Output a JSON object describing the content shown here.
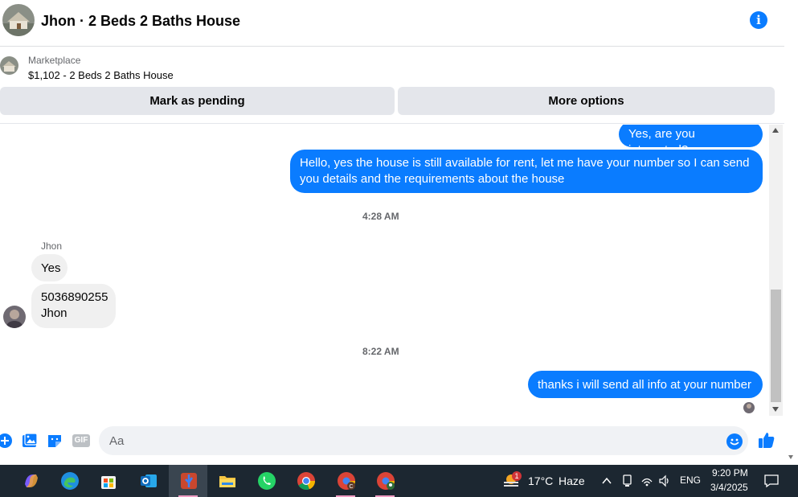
{
  "header": {
    "title": "Jhon · 2 Beds 2 Baths House",
    "info_icon": "info-icon"
  },
  "marketplace": {
    "label": "Marketplace",
    "item": "$1,102 - 2 Beds 2 Baths House",
    "pending_button": "Mark as pending",
    "more_button": "More options"
  },
  "messages": {
    "m1": "Yes, are you interested?",
    "m2": "Hello, yes the house is still available for rent, let me have your number so I can send you details and the requirements about the house",
    "time1": "4:28 AM",
    "sender": "Jhon",
    "m3": "Yes",
    "m4a": "5036890255",
    "m4b": "Jhon",
    "time2": "8:22 AM",
    "m5": "thanks i will send all info at your number"
  },
  "composer": {
    "placeholder": "Aa",
    "gif_label": "GIF"
  },
  "taskbar": {
    "weather_temp": "17°C",
    "weather_desc": "Haze",
    "weather_badge": "1",
    "language": "ENG",
    "time": "9:20 PM",
    "date": "3/4/2025"
  },
  "colors": {
    "accent": "#0a7cff",
    "taskbar": "#1c2731"
  }
}
